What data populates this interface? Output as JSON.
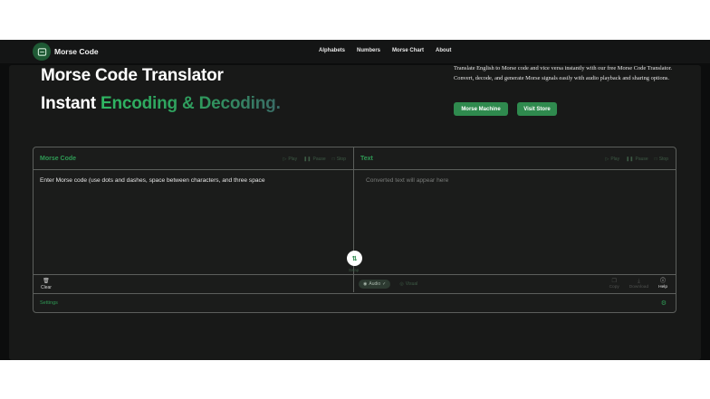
{
  "nav": {
    "brand": "Morse Code",
    "links": [
      "Alphabets",
      "Numbers",
      "Morse Chart",
      "About"
    ]
  },
  "hero": {
    "title_line1": "Morse Code Translator",
    "title_line2_plain": "Instant",
    "title_line2_highlight": "Encoding & Decoding.",
    "description": "Translate English to Morse code and vice versa instantly with our free Morse Code Translator. Convert, decode, and generate Morse signals easily with audio playback and sharing options.",
    "btn_machine": "Morse Machine",
    "btn_store": "Visit Store"
  },
  "translator": {
    "left": {
      "title": "Morse Code",
      "play": "Play",
      "pause": "Pause",
      "stop": "Stop",
      "placeholder": "Enter Morse code (use dots and dashes, space between characters, and three space"
    },
    "right": {
      "title": "Text",
      "play": "Play",
      "pause": "Pause",
      "stop": "Stop",
      "placeholder": "Converted text will appear here"
    },
    "swap_label": "Swap",
    "clear": "Clear",
    "audio": "Audio",
    "visual": "Visual",
    "copy": "Copy",
    "download": "Download",
    "help": "Help",
    "settings": "Settings"
  },
  "colors": {
    "accent": "#2f8a4e",
    "accent_text": "#2f9a55",
    "background": "#0c0d0d"
  }
}
